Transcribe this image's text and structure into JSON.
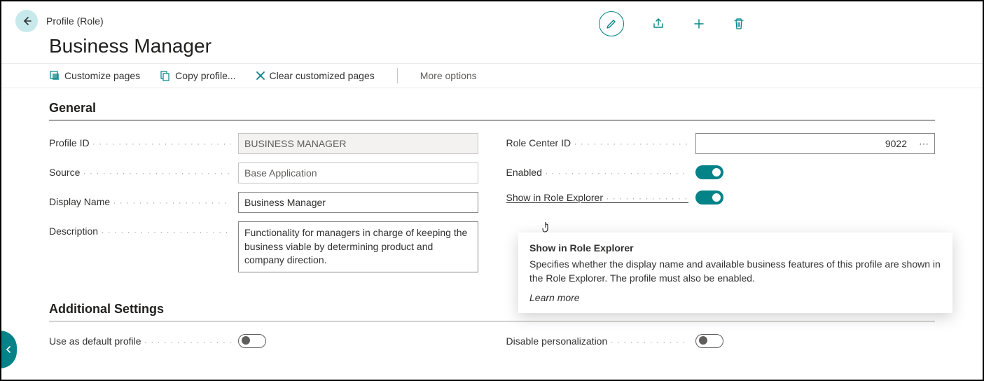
{
  "breadcrumb": "Profile (Role)",
  "title": "Business Manager",
  "toolbar": {
    "customize": "Customize pages",
    "copy": "Copy profile...",
    "clear": "Clear customized pages",
    "more": "More options"
  },
  "sections": {
    "general": "General",
    "additional": "Additional Settings"
  },
  "fields": {
    "profile_id": {
      "label": "Profile ID",
      "value": "BUSINESS MANAGER"
    },
    "source": {
      "label": "Source",
      "value": "Base Application"
    },
    "display_name": {
      "label": "Display Name",
      "value": "Business Manager"
    },
    "description": {
      "label": "Description",
      "value": "Functionality for managers in charge of keeping the business viable by determining product and company direction."
    },
    "role_center_id": {
      "label": "Role Center ID",
      "value": "9022"
    },
    "enabled": {
      "label": "Enabled",
      "on": true
    },
    "show_in_role_explorer": {
      "label": "Show in Role Explorer",
      "on": true
    },
    "use_as_default": {
      "label": "Use as default profile",
      "on": false
    },
    "disable_personalization": {
      "label": "Disable personalization",
      "on": false
    }
  },
  "tooltip": {
    "title": "Show in Role Explorer",
    "body": "Specifies whether the display name and available business features of this profile are shown in the Role Explorer. The profile must also be enabled.",
    "learn": "Learn more"
  },
  "colors": {
    "accent": "#038387"
  }
}
